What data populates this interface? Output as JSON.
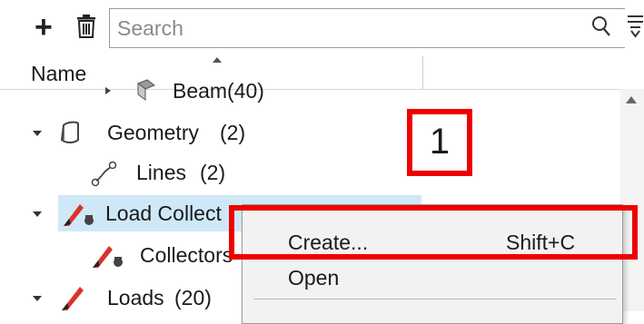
{
  "toolbar": {
    "add_icon": "plus-icon",
    "delete_icon": "trash-icon",
    "search": {
      "placeholder": "Search",
      "value": ""
    },
    "search_icon": "magnifier-icon",
    "filter_icon": "filter-icon"
  },
  "header": {
    "name_label": "Name"
  },
  "tree": {
    "items": [
      {
        "label": "Beam",
        "count": "(40)",
        "icon": "beam-icon",
        "expanded": false,
        "partial": true
      },
      {
        "label": "Geometry",
        "count": "(2)",
        "icon": "geometry-icon",
        "expanded": true
      },
      {
        "label": "Lines",
        "count": "(2)",
        "icon": "line-icon",
        "child": true
      },
      {
        "label": "Load Collect",
        "count": "",
        "icon": "load-collector-icon",
        "expanded": true,
        "selected": true
      },
      {
        "label": "Collectors",
        "count": "",
        "icon": "load-collector-icon",
        "child": true
      },
      {
        "label": "Loads",
        "count": "(20)",
        "icon": "load-icon",
        "expanded": true
      }
    ]
  },
  "context_menu": {
    "items": [
      {
        "label": "Create...",
        "shortcut": "Shift+C"
      },
      {
        "label": "Open",
        "shortcut": ""
      }
    ]
  },
  "callouts": {
    "step1": "1"
  },
  "colors": {
    "callout": "#ee0000",
    "selection": "#cfe8f7",
    "menu_bg": "#f2f2f2"
  }
}
